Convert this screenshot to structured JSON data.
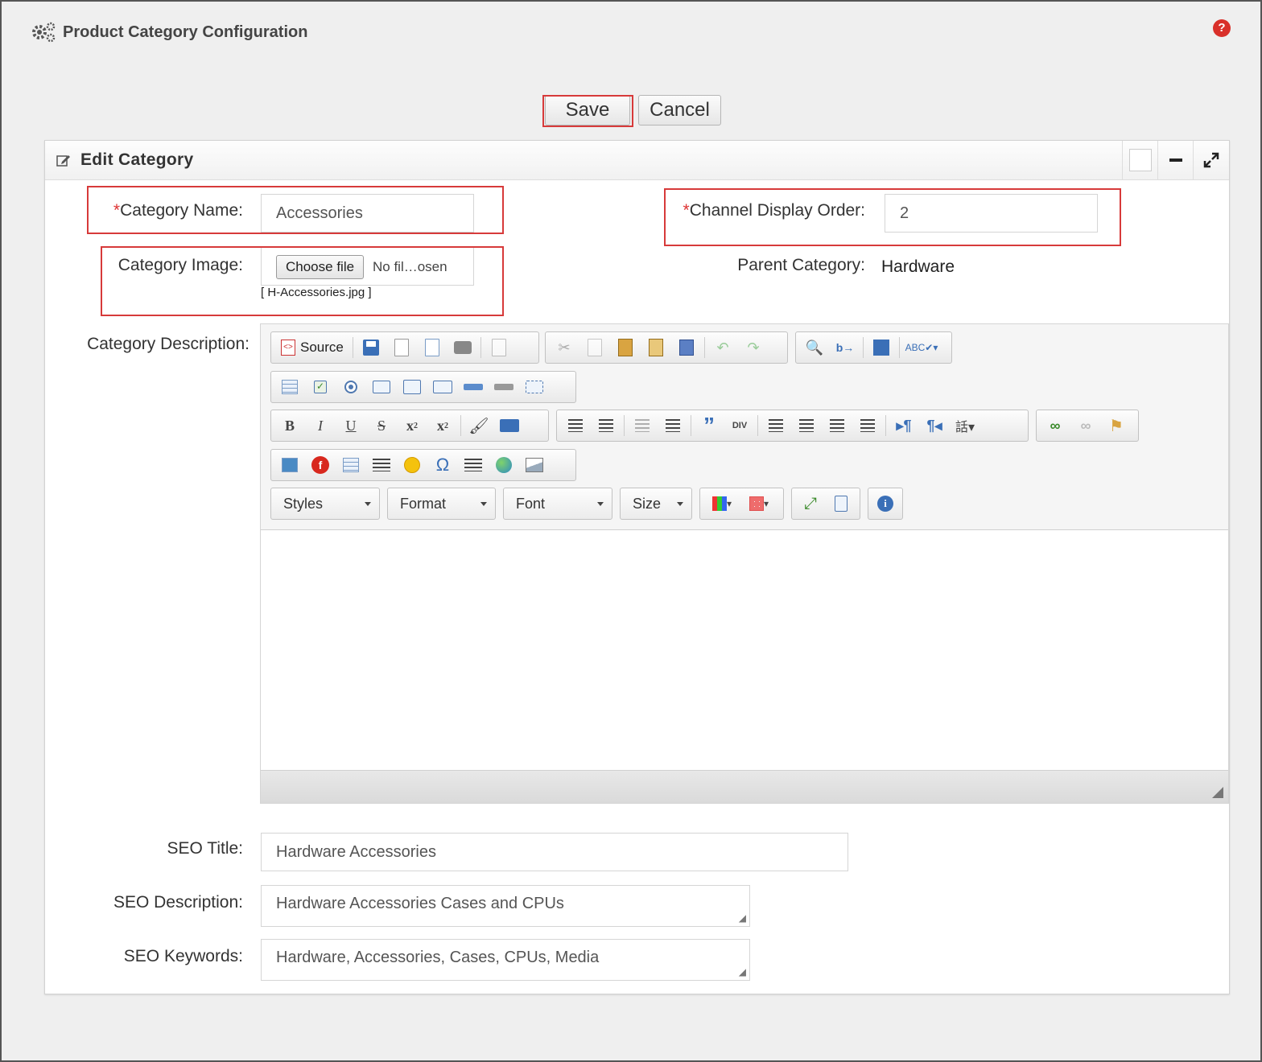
{
  "page": {
    "title": "Product Category Configuration",
    "help_icon": "help-icon"
  },
  "actions": {
    "save_label": "Save",
    "cancel_label": "Cancel"
  },
  "panel": {
    "title": "Edit Category",
    "icon": "edit-icon",
    "controls": [
      "checkbox",
      "collapse-icon",
      "expand-icon"
    ]
  },
  "form": {
    "category_name": {
      "label": "Category Name:",
      "required_mark": "*",
      "value": "Accessories"
    },
    "channel_display_order": {
      "label": "Channel Display Order:",
      "required_mark": "*",
      "value": "2"
    },
    "category_image": {
      "label": "Category Image:",
      "button_label": "Choose file",
      "file_status": "No fil…osen",
      "current_file": "[ H-Accessories.jpg ]"
    },
    "parent_category": {
      "label": "Parent Category:",
      "value": "Hardware"
    },
    "category_description": {
      "label": "Category Description:"
    },
    "seo_title": {
      "label": "SEO Title:",
      "value": "Hardware Accessories"
    },
    "seo_description": {
      "label": "SEO Description:",
      "value": "Hardware Accessories Cases and CPUs"
    },
    "seo_keywords": {
      "label": "SEO Keywords:",
      "value": "Hardware, Accessories, Cases, CPUs, Media"
    }
  },
  "editor": {
    "source_label": "Source",
    "styles_label": "Styles",
    "format_label": "Format",
    "font_label": "Font",
    "size_label": "Size",
    "bold": "B",
    "italic": "I",
    "underline": "U",
    "strike": "S",
    "omega": "Ω"
  },
  "colors": {
    "highlight": "#d73a3a",
    "required": "#dd3333",
    "help": "#d9302a"
  }
}
